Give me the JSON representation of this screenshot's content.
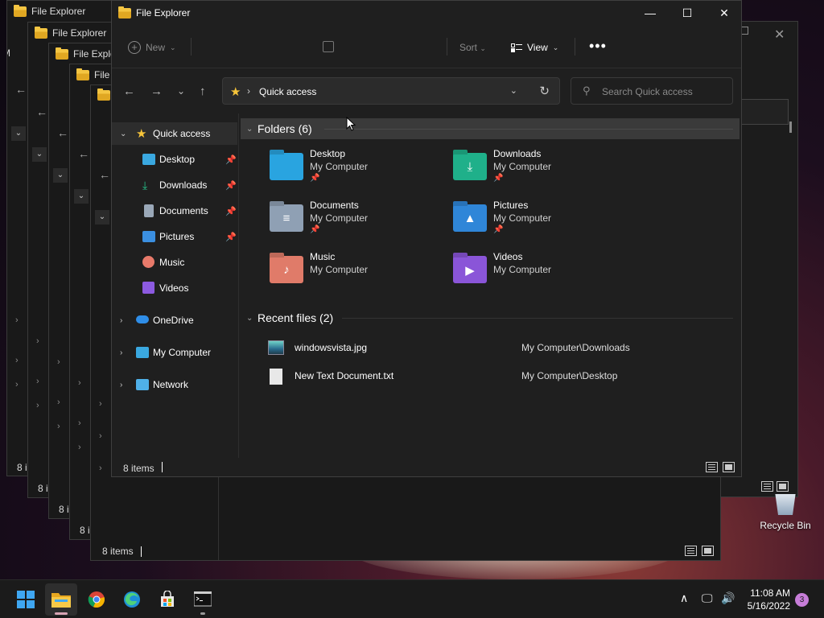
{
  "window": {
    "title": "File Explorer",
    "minimize_glyph": "—",
    "maximize_glyph": "☐",
    "close_glyph": "✕"
  },
  "ghost_windows": {
    "titles": [
      "File Explorer",
      "File Explorer",
      "File Explore",
      "File E",
      ""
    ],
    "item_counts": [
      "8 i",
      "8 i",
      "8 i",
      "8 i"
    ],
    "side_letter": "M"
  },
  "toolbar": {
    "new_label": "New",
    "sort_label": "Sort",
    "view_label": "View",
    "more_label": "•••"
  },
  "nav": {
    "back": "←",
    "forward": "→",
    "recent": "⌄",
    "up": "↑"
  },
  "address": {
    "location": "Quick access",
    "separator": "›",
    "refresh": "↻"
  },
  "search": {
    "placeholder": "Search Quick access"
  },
  "sidebar": {
    "items": [
      {
        "label": "Quick access",
        "icon": "star-icon",
        "color": "#f7c53a",
        "expanded": true,
        "selected": true
      },
      {
        "label": "Desktop",
        "icon": "desktop-icon",
        "color": "#3aa8e0",
        "pinned": true
      },
      {
        "label": "Downloads",
        "icon": "download-icon",
        "color": "#27c08a",
        "pinned": true
      },
      {
        "label": "Documents",
        "icon": "documents-icon",
        "color": "#9aa8b8",
        "pinned": true
      },
      {
        "label": "Pictures",
        "icon": "pictures-icon",
        "color": "#3b8fe0",
        "pinned": true
      },
      {
        "label": "Music",
        "icon": "music-icon",
        "color": "#e87a6a"
      },
      {
        "label": "Videos",
        "icon": "videos-icon",
        "color": "#8c5ae0"
      },
      {
        "label": "OneDrive",
        "icon": "cloud-icon",
        "color": "#2f8ee8"
      },
      {
        "label": "My Computer",
        "icon": "computer-icon",
        "color": "#3aa8e0"
      },
      {
        "label": "Network",
        "icon": "network-icon",
        "color": "#4fb0e8"
      }
    ]
  },
  "folders_group": {
    "label": "Folders (6)",
    "items": [
      {
        "name": "Desktop",
        "location": "My Computer",
        "pinned": true,
        "color": "#29a4e0",
        "glyph": ""
      },
      {
        "name": "Downloads",
        "location": "My Computer",
        "pinned": true,
        "color": "#1fb08a",
        "glyph": "⤓"
      },
      {
        "name": "Documents",
        "location": "My Computer",
        "pinned": true,
        "color": "#8fa0b4",
        "glyph": "≡"
      },
      {
        "name": "Pictures",
        "location": "My Computer",
        "pinned": true,
        "color": "#2f86d8",
        "glyph": "▲"
      },
      {
        "name": "Music",
        "location": "My Computer",
        "pinned": false,
        "color": "#e07b69",
        "glyph": "♪"
      },
      {
        "name": "Videos",
        "location": "My Computer",
        "pinned": false,
        "color": "#8a55d8",
        "glyph": "▶"
      }
    ]
  },
  "recent_group": {
    "label": "Recent files (2)",
    "items": [
      {
        "name": "windowsvista.jpg",
        "path": "My Computer\\Downloads",
        "icon": "image-file-icon"
      },
      {
        "name": "New Text Document.txt",
        "path": "My Computer\\Desktop",
        "icon": "text-file-icon"
      }
    ]
  },
  "status": {
    "item_count": "8 items"
  },
  "desktop": {
    "recycle_bin_label": "Recycle Bin"
  },
  "taskbar": {
    "apps": [
      {
        "name": "start-button",
        "icon": "windows-logo-icon"
      },
      {
        "name": "taskbar-file-explorer",
        "icon": "folder-icon",
        "active": true
      },
      {
        "name": "taskbar-chrome",
        "icon": "chrome-icon"
      },
      {
        "name": "taskbar-edge",
        "icon": "edge-icon"
      },
      {
        "name": "taskbar-store",
        "icon": "store-icon"
      },
      {
        "name": "taskbar-terminal",
        "icon": "terminal-icon"
      }
    ],
    "time": "11:08 AM",
    "date": "5/16/2022",
    "notification_count": "3"
  }
}
